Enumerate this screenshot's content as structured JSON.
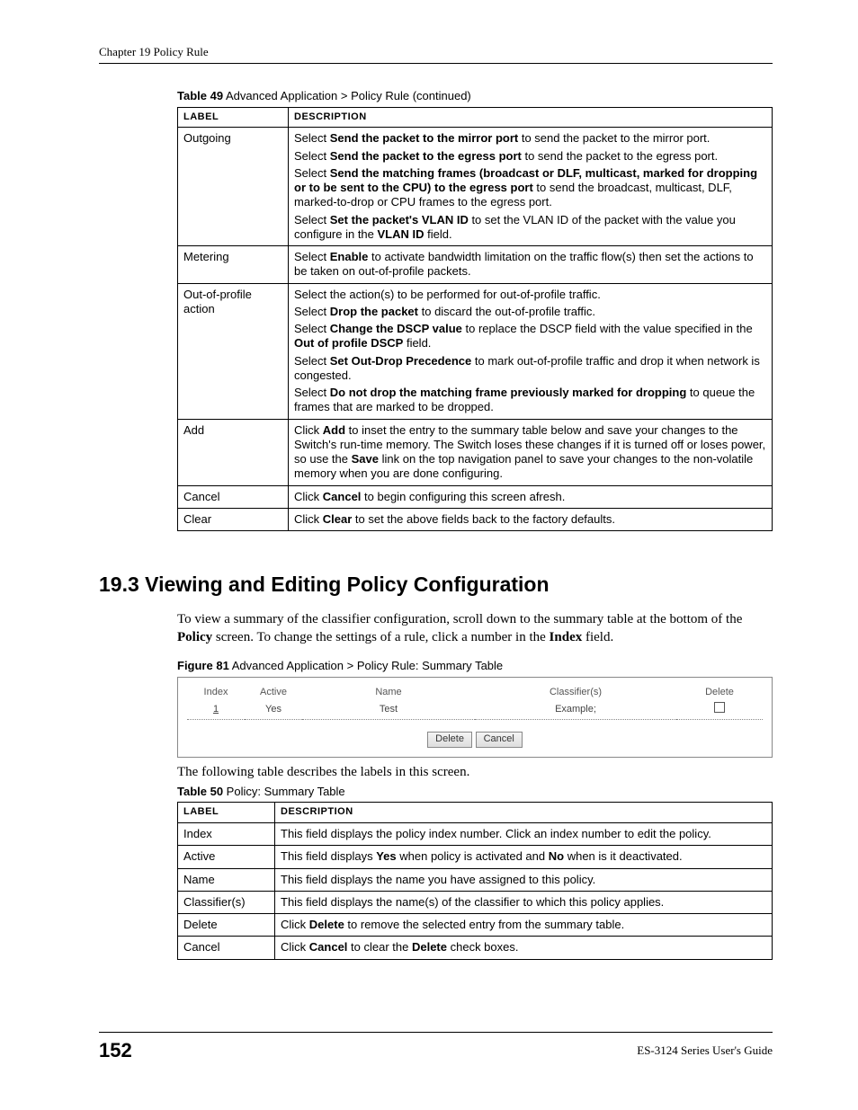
{
  "chapter_header": "Chapter 19 Policy Rule",
  "table49": {
    "caption_bold": "Table 49",
    "caption_rest": "   Advanced Application > Policy Rule (continued)",
    "head_label": "LABEL",
    "head_desc": "DESCRIPTION",
    "rows": [
      {
        "label": "Outgoing",
        "paras": [
          [
            {
              "t": "Select "
            },
            {
              "b": "Send the packet to the mirror port"
            },
            {
              "t": " to send the packet to the mirror port."
            }
          ],
          [
            {
              "t": "Select "
            },
            {
              "b": "Send the packet to the egress port"
            },
            {
              "t": " to send the packet to the egress port."
            }
          ],
          [
            {
              "t": "Select "
            },
            {
              "b": "Send the matching frames (broadcast or DLF, multicast, marked for dropping or to be sent to the CPU) to the egress port"
            },
            {
              "t": " to send the broadcast, multicast, DLF, marked-to-drop or CPU frames to the egress port."
            }
          ],
          [
            {
              "t": "Select "
            },
            {
              "b": "Set the packet's VLAN ID"
            },
            {
              "t": " to set the VLAN ID of the packet with the value you configure in the "
            },
            {
              "b": "VLAN ID"
            },
            {
              "t": " field."
            }
          ]
        ]
      },
      {
        "label": "Metering",
        "paras": [
          [
            {
              "t": "Select "
            },
            {
              "b": "Enable"
            },
            {
              "t": " to activate bandwidth limitation on the traffic flow(s) then set the actions to be taken on out-of-profile packets."
            }
          ]
        ]
      },
      {
        "label": "Out-of-profile action",
        "paras": [
          [
            {
              "t": "Select the action(s) to be performed for out-of-profile traffic."
            }
          ],
          [
            {
              "t": "Select "
            },
            {
              "b": "Drop the packet"
            },
            {
              "t": " to discard the out-of-profile traffic."
            }
          ],
          [
            {
              "t": "Select "
            },
            {
              "b": "Change the DSCP value"
            },
            {
              "t": " to replace the DSCP field with the value specified in the "
            },
            {
              "b": "Out of profile DSCP"
            },
            {
              "t": " field."
            }
          ],
          [
            {
              "t": "Select "
            },
            {
              "b": "Set Out-Drop Precedence"
            },
            {
              "t": " to mark out-of-profile traffic and drop it when network is congested."
            }
          ],
          [
            {
              "t": "Select "
            },
            {
              "b": "Do not drop the matching frame previously marked for dropping"
            },
            {
              "t": " to queue the frames that are marked to be dropped."
            }
          ]
        ]
      },
      {
        "label": "Add",
        "paras": [
          [
            {
              "t": "Click "
            },
            {
              "b": "Add"
            },
            {
              "t": " to inset the entry to the summary table below and save your changes to the Switch's run-time memory. The Switch loses these changes if it is turned off or loses power, so use the "
            },
            {
              "b": "Save"
            },
            {
              "t": " link on the top navigation panel to save your changes to the non-volatile memory when you are done configuring."
            }
          ]
        ]
      },
      {
        "label": "Cancel",
        "paras": [
          [
            {
              "t": "Click "
            },
            {
              "b": "Cancel"
            },
            {
              "t": " to begin configuring this screen afresh."
            }
          ]
        ]
      },
      {
        "label": "Clear",
        "paras": [
          [
            {
              "t": "Click "
            },
            {
              "b": "Clear"
            },
            {
              "t": " to set the above fields back to the factory defaults."
            }
          ]
        ]
      }
    ]
  },
  "section_heading": "19.3  Viewing and Editing Policy Configuration",
  "intro_para": {
    "parts": [
      {
        "t": "To view a summary of the classifier configuration, scroll down to the summary table at the bottom of the "
      },
      {
        "b": "Policy"
      },
      {
        "t": " screen. To change the settings of a rule, click a number in the "
      },
      {
        "b": "Index"
      },
      {
        "t": " field."
      }
    ]
  },
  "figure81": {
    "caption_bold": "Figure 81",
    "caption_rest": "   Advanced Application > Policy Rule: Summary Table",
    "headers": {
      "index": "Index",
      "active": "Active",
      "name": "Name",
      "classifiers": "Classifier(s)",
      "delete": "Delete"
    },
    "row": {
      "index": "1",
      "active": "Yes",
      "name": "Test",
      "classifiers": "Example;"
    },
    "btn_delete": "Delete",
    "btn_cancel": "Cancel"
  },
  "after_figure_text": "The following table describes the labels in this screen.",
  "table50": {
    "caption_bold": "Table 50",
    "caption_rest": "   Policy: Summary Table",
    "head_label": "LABEL",
    "head_desc": "DESCRIPTION",
    "rows": [
      {
        "label": "Index",
        "paras": [
          [
            {
              "t": "This field displays the policy index number. Click an index number to edit the policy."
            }
          ]
        ]
      },
      {
        "label": "Active",
        "paras": [
          [
            {
              "t": "This field displays "
            },
            {
              "b": "Yes"
            },
            {
              "t": " when policy is activated and "
            },
            {
              "b": "No"
            },
            {
              "t": " when is it deactivated."
            }
          ]
        ]
      },
      {
        "label": "Name",
        "paras": [
          [
            {
              "t": "This field displays the name you have assigned to this policy."
            }
          ]
        ]
      },
      {
        "label": "Classifier(s)",
        "paras": [
          [
            {
              "t": "This field displays the name(s) of the classifier to which this policy applies."
            }
          ]
        ]
      },
      {
        "label": "Delete",
        "paras": [
          [
            {
              "t": "Click "
            },
            {
              "b": "Delete"
            },
            {
              "t": " to remove the selected entry from the summary table."
            }
          ]
        ]
      },
      {
        "label": "Cancel",
        "paras": [
          [
            {
              "t": "Click "
            },
            {
              "b": "Cancel"
            },
            {
              "t": " to clear the "
            },
            {
              "b": "Delete"
            },
            {
              "t": " check boxes."
            }
          ]
        ]
      }
    ]
  },
  "page_number": "152",
  "guide_title": "ES-3124 Series User's Guide"
}
